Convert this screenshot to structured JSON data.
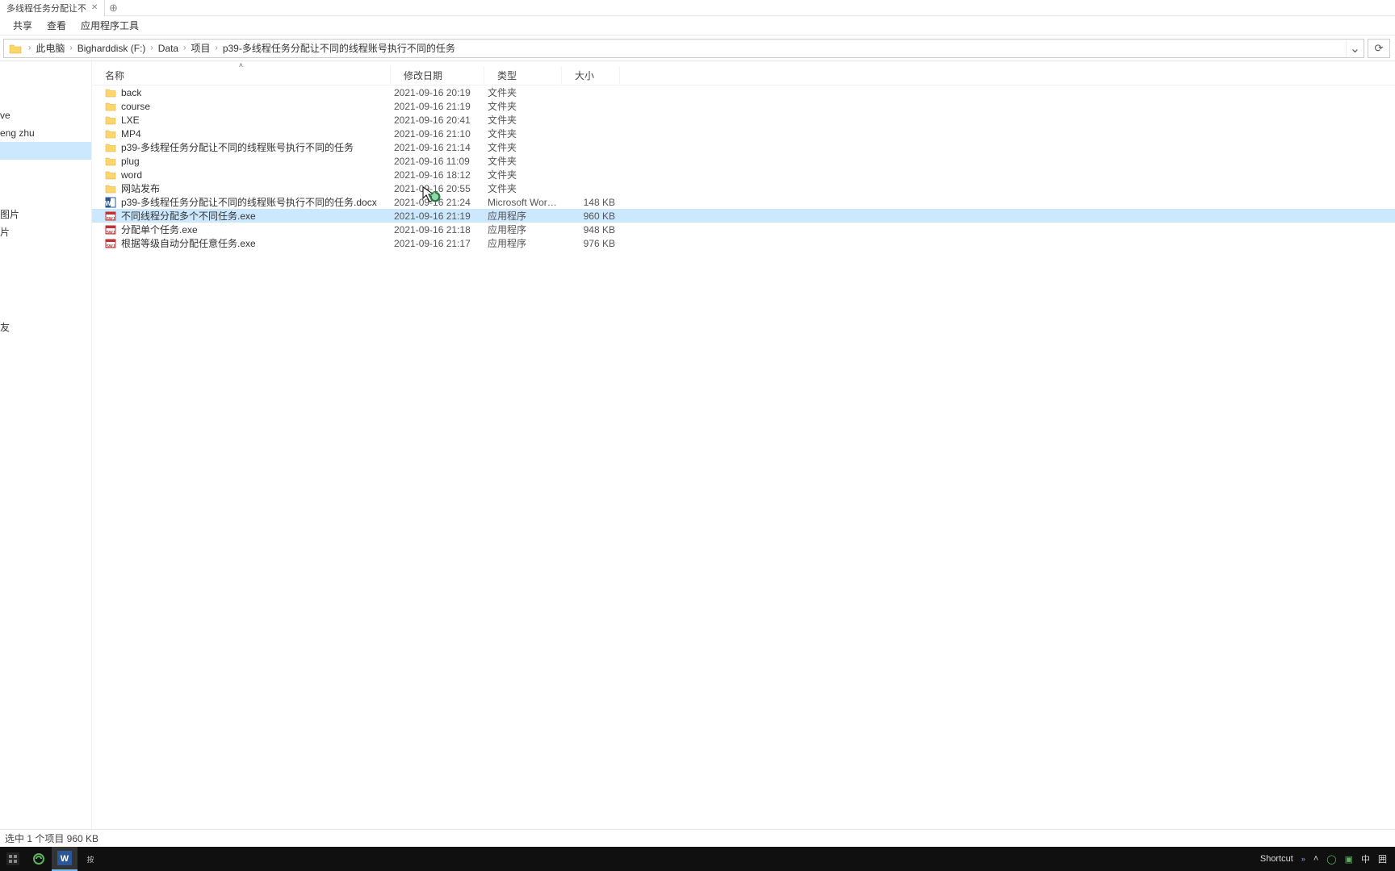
{
  "tab": {
    "title": "多线程任务分配让不"
  },
  "menu": {
    "share": "共享",
    "view": "查看",
    "app_tools": "应用程序工具"
  },
  "breadcrumb": {
    "root": "此电脑",
    "drive": "Bigharddisk (F:)",
    "p1": "Data",
    "p2": "项目",
    "p3": "p39-多线程任务分配让不同的线程账号执行不同的任务"
  },
  "columns": {
    "name": "名称",
    "date": "修改日期",
    "type": "类型",
    "size": "大小"
  },
  "sidebar": {
    "items": [
      {
        "label": "ve"
      },
      {
        "label": "eng zhu"
      },
      {
        "label": ""
      },
      {
        "label": "图片"
      },
      {
        "label": "片"
      },
      {
        "label": ""
      },
      {
        "label": "友"
      }
    ]
  },
  "rows": [
    {
      "icon": "folder",
      "name": "back",
      "date": "2021-09-16 20:19",
      "type": "文件夹",
      "size": ""
    },
    {
      "icon": "folder",
      "name": "course",
      "date": "2021-09-16 21:19",
      "type": "文件夹",
      "size": ""
    },
    {
      "icon": "folder",
      "name": "LXE",
      "date": "2021-09-16 20:41",
      "type": "文件夹",
      "size": ""
    },
    {
      "icon": "folder",
      "name": "MP4",
      "date": "2021-09-16 21:10",
      "type": "文件夹",
      "size": ""
    },
    {
      "icon": "folder",
      "name": "p39-多线程任务分配让不同的线程账号执行不同的任务",
      "date": "2021-09-16 21:14",
      "type": "文件夹",
      "size": ""
    },
    {
      "icon": "folder",
      "name": "plug",
      "date": "2021-09-16 11:09",
      "type": "文件夹",
      "size": ""
    },
    {
      "icon": "folder",
      "name": "word",
      "date": "2021-09-16 18:12",
      "type": "文件夹",
      "size": ""
    },
    {
      "icon": "folder",
      "name": "网站发布",
      "date": "2021-09-16 20:55",
      "type": "文件夹",
      "size": ""
    },
    {
      "icon": "docx",
      "name": "p39-多线程任务分配让不同的线程账号执行不同的任务.docx",
      "date": "2021-09-16 21:24",
      "type": "Microsoft Word ...",
      "size": "148 KB"
    },
    {
      "icon": "exe",
      "name": "不同线程分配多个不同任务.exe",
      "date": "2021-09-16 21:19",
      "type": "应用程序",
      "size": "960 KB",
      "selected": true
    },
    {
      "icon": "exe",
      "name": "分配单个任务.exe",
      "date": "2021-09-16 21:18",
      "type": "应用程序",
      "size": "948 KB"
    },
    {
      "icon": "exe",
      "name": "根据等级自动分配任意任务.exe",
      "date": "2021-09-16 21:17",
      "type": "应用程序",
      "size": "976 KB"
    }
  ],
  "status": {
    "text": "选中 1 个项目  960 KB"
  },
  "taskbar": {
    "shortcut": "Shortcut",
    "ime_lang": "中",
    "ime_mode": "囲"
  }
}
